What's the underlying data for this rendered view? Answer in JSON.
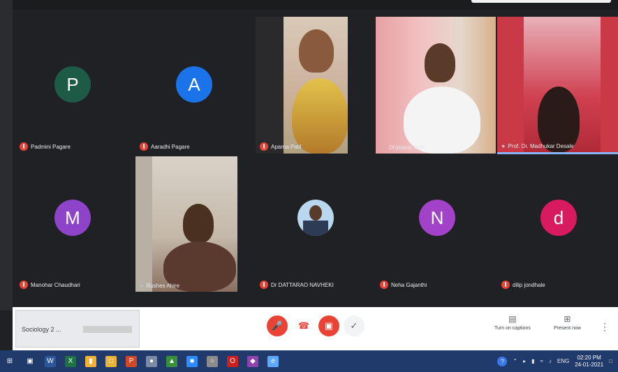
{
  "participants_row1": [
    {
      "name": "Padmini Pagare",
      "initial": "P",
      "color": "#1e5b47"
    },
    {
      "name": "Aaradhi Pagare",
      "initial": "A",
      "color": "#1a73e8"
    },
    {
      "name": "Aparna Patil",
      "video": true
    },
    {
      "name": "Dhimaraj Jadh",
      "video": true
    },
    {
      "name": "Prof. Dr. Madhukar Desale",
      "video": true
    }
  ],
  "participants_row2": [
    {
      "name": "Manohar Chaudhari",
      "initial": "M",
      "color": "#8e44c8"
    },
    {
      "name": "Rushes Ahire",
      "video": true
    },
    {
      "name": "Dr DATTARAO NAVHEKI",
      "video": true
    },
    {
      "name": "Neha Gajanthi",
      "initial": "N",
      "color": "#a142c9"
    },
    {
      "name": "dilip jondhale",
      "initial": "d",
      "color": "#d81b60"
    }
  ],
  "controls": {
    "presentation_label": "Sociology 2 ...",
    "mic_icon": "mic-off-icon",
    "end_icon": "phone-hangup-icon",
    "camera_icon": "camera-off-icon",
    "hand_icon": "raise-hand-icon",
    "captions_label": "Turn on captions",
    "present_label": "Present now"
  },
  "taskbar": {
    "language": "ENG",
    "time": "02:20 PM",
    "date": "24-01-2021"
  }
}
